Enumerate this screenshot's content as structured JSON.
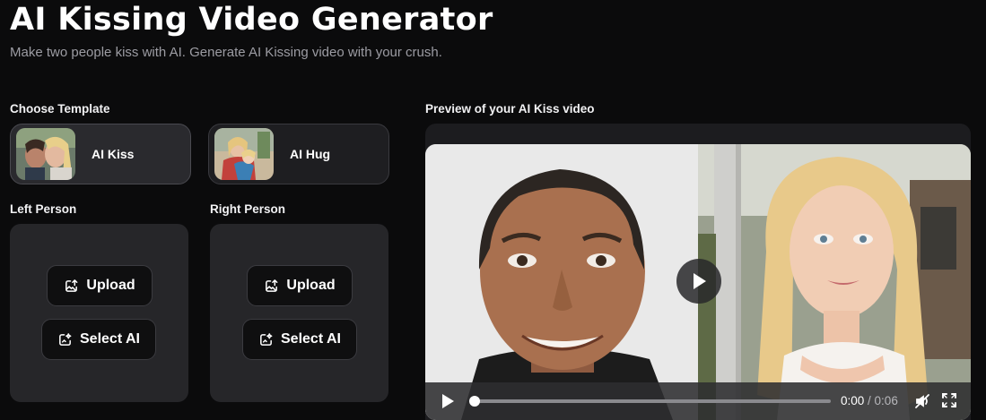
{
  "header": {
    "title": "AI Kissing Video Generator",
    "subtitle": "Make two people kiss with AI. Generate AI Kissing video with your crush."
  },
  "templates": {
    "label": "Choose Template",
    "items": [
      {
        "name": "AI Kiss",
        "selected": true
      },
      {
        "name": "AI Hug",
        "selected": false
      }
    ]
  },
  "left_person": {
    "label": "Left Person",
    "upload_label": "Upload",
    "select_ai_label": "Select AI"
  },
  "right_person": {
    "label": "Right Person",
    "upload_label": "Upload",
    "select_ai_label": "Select AI"
  },
  "preview": {
    "label": "Preview of your AI Kiss video",
    "current_time": "0:00",
    "separator": " / ",
    "duration": "0:06",
    "progress": 0
  },
  "colors": {
    "background": "#0b0b0c",
    "panel": "#262629",
    "button": "#0f0f10"
  }
}
